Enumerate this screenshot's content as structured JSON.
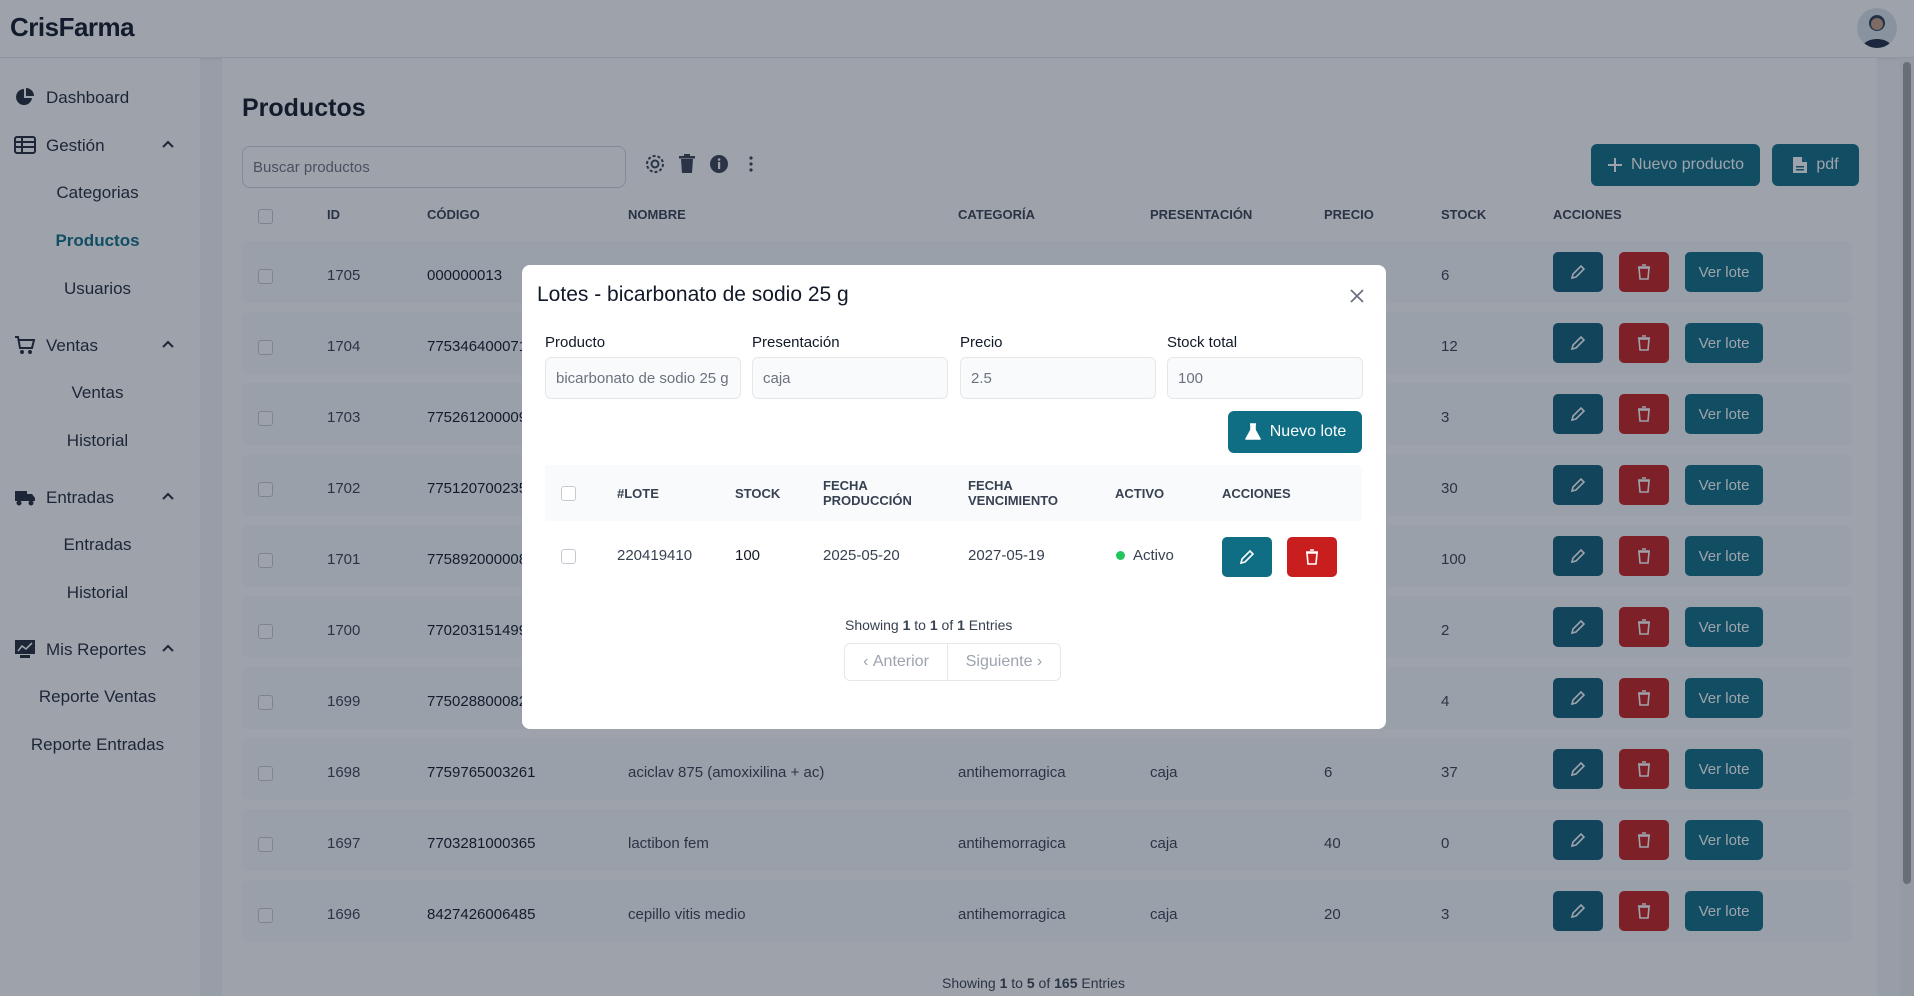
{
  "app": {
    "brand": "CrisFarma"
  },
  "sidebar": {
    "items": [
      {
        "label": "Dashboard"
      },
      {
        "label": "Gestión",
        "children": [
          "Categorias",
          "Productos",
          "Usuarios"
        ]
      },
      {
        "label": "Ventas",
        "children": [
          "Ventas",
          "Historial"
        ]
      },
      {
        "label": "Entradas",
        "children": [
          "Entradas",
          "Historial"
        ]
      },
      {
        "label": "Mis Reportes",
        "children": [
          "Reporte Ventas",
          "Reporte Entradas"
        ]
      }
    ],
    "active": "Productos"
  },
  "page": {
    "title": "Productos",
    "search_placeholder": "Buscar productos",
    "new_product_label": "Nuevo producto",
    "pdf_label": "pdf"
  },
  "table": {
    "headers": [
      "ID",
      "CÓDIGO",
      "NOMBRE",
      "CATEGORÍA",
      "PRESENTACIÓN",
      "PRECIO",
      "STOCK",
      "ACCIONES"
    ],
    "rows": [
      {
        "id": "1705",
        "codigo": "000000013",
        "nombre": "",
        "categoria": "",
        "presentacion": "",
        "precio": "",
        "stock": "6"
      },
      {
        "id": "1704",
        "codigo": "775346400071",
        "nombre": "",
        "categoria": "",
        "presentacion": "",
        "precio": "",
        "stock": "12"
      },
      {
        "id": "1703",
        "codigo": "775261200009",
        "nombre": "",
        "categoria": "",
        "presentacion": "",
        "precio": "",
        "stock": "3"
      },
      {
        "id": "1702",
        "codigo": "775120700235",
        "nombre": "",
        "categoria": "",
        "presentacion": "",
        "precio": "",
        "stock": "30"
      },
      {
        "id": "1701",
        "codigo": "775892000008",
        "nombre": "",
        "categoria": "",
        "presentacion": "",
        "precio": "",
        "stock": "100"
      },
      {
        "id": "1700",
        "codigo": "770203151499",
        "nombre": "",
        "categoria": "",
        "presentacion": "",
        "precio": "",
        "stock": "2"
      },
      {
        "id": "1699",
        "codigo": "775028800082",
        "nombre": "",
        "categoria": "",
        "presentacion": "",
        "precio": "",
        "stock": "4"
      },
      {
        "id": "1698",
        "codigo": "7759765003261",
        "nombre": "aciclav 875 (amoxixilina + ac)",
        "categoria": "antihemorragica",
        "presentacion": "caja",
        "precio": "6",
        "stock": "37"
      },
      {
        "id": "1697",
        "codigo": "7703281000365",
        "nombre": "lactibon fem",
        "categoria": "antihemorragica",
        "presentacion": "caja",
        "precio": "40",
        "stock": "0"
      },
      {
        "id": "1696",
        "codigo": "8427426006485",
        "nombre": "cepillo vitis medio",
        "categoria": "antihemorragica",
        "presentacion": "caja",
        "precio": "20",
        "stock": "3"
      }
    ],
    "ver_lote_label": "Ver lote"
  },
  "footer": {
    "prefix": "Showing ",
    "from": "1",
    "to_word": " to ",
    "to": "5",
    "of_word": " of ",
    "total": "165",
    "suffix": " Entries"
  },
  "modal": {
    "title": "Lotes - bicarbonato de sodio 25 g",
    "fields": [
      {
        "label": "Producto",
        "value": "bicarbonato de sodio 25 g"
      },
      {
        "label": "Presentación",
        "value": "caja"
      },
      {
        "label": "Precio",
        "value": "2.5"
      },
      {
        "label": "Stock total",
        "value": "100"
      }
    ],
    "new_lote_label": "Nuevo lote",
    "headers": {
      "lote": "#LOTE",
      "stock": "STOCK",
      "fprod_1": "FECHA",
      "fprod_2": "PRODUCCIÓN",
      "fvenc_1": "FECHA",
      "fvenc_2": "VENCIMIENTO",
      "activo": "ACTIVO",
      "acciones": "ACCIONES"
    },
    "row": {
      "lote": "220419410",
      "stock": "100",
      "fecha_produccion": "2025-05-20",
      "fecha_vencimiento": "2027-05-19",
      "activo": "Activo"
    },
    "showing": {
      "prefix": "Showing ",
      "from": "1",
      "to_word": " to ",
      "to": "1",
      "of_word": " of ",
      "total": "1",
      "suffix": " Entries"
    },
    "prev_label": "Anterior",
    "next_label": "Siguiente"
  },
  "colors": {
    "accent": "#0f6d84",
    "edit": "#0f5c78",
    "danger": "#c81e1e",
    "active_dot": "#22c55e"
  }
}
